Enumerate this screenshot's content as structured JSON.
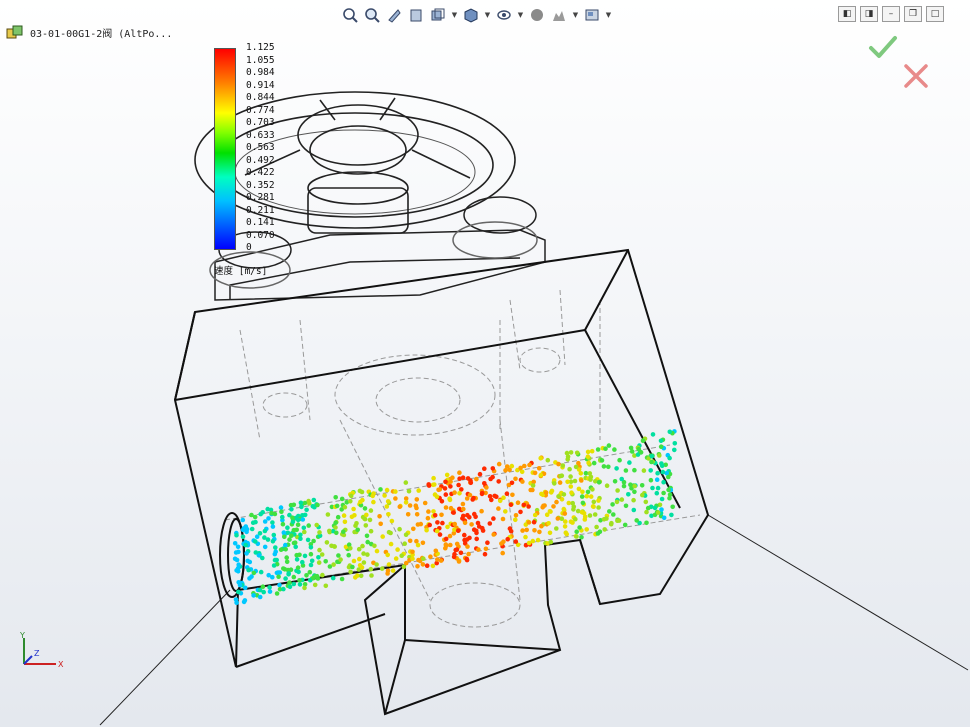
{
  "document": {
    "title": "03-01-00G1-2阀  (AltPo..."
  },
  "toolbar": {
    "items": [
      {
        "icon": "zoom-to-fit-icon"
      },
      {
        "icon": "zoom-to-area-icon"
      },
      {
        "icon": "previous-view-icon"
      },
      {
        "icon": "section-view-icon"
      },
      {
        "icon": "view-orientation-icon",
        "dropdown": true
      },
      {
        "icon": "display-style-icon",
        "dropdown": true
      },
      {
        "icon": "hide-show-items-icon",
        "dropdown": true
      },
      {
        "icon": "edit-appearance-icon"
      },
      {
        "icon": "apply-scene-icon",
        "dropdown": true
      },
      {
        "icon": "view-settings-icon",
        "dropdown": true
      }
    ]
  },
  "window_controls": [
    "restore-left-icon",
    "restore-right-icon",
    "minimize-icon",
    "tile-icon",
    "maximize-icon"
  ],
  "legend": {
    "ticks": [
      "1.125",
      "1.055",
      "0.984",
      "0.914",
      "0.844",
      "0.774",
      "0.703",
      "0.633",
      "0.563",
      "0.492",
      "0.422",
      "0.352",
      "0.281",
      "0.211",
      "0.141",
      "0.070",
      "0"
    ],
    "unit": "速度 [m/s]",
    "colors": {
      "max": "#ff0000",
      "min": "#0000ff"
    }
  },
  "confirm_corner": {
    "accept_color": "#7fc97f",
    "cancel_color": "#e88a8a"
  },
  "triad": {
    "x": "X",
    "y": "Y",
    "z": "Z"
  }
}
